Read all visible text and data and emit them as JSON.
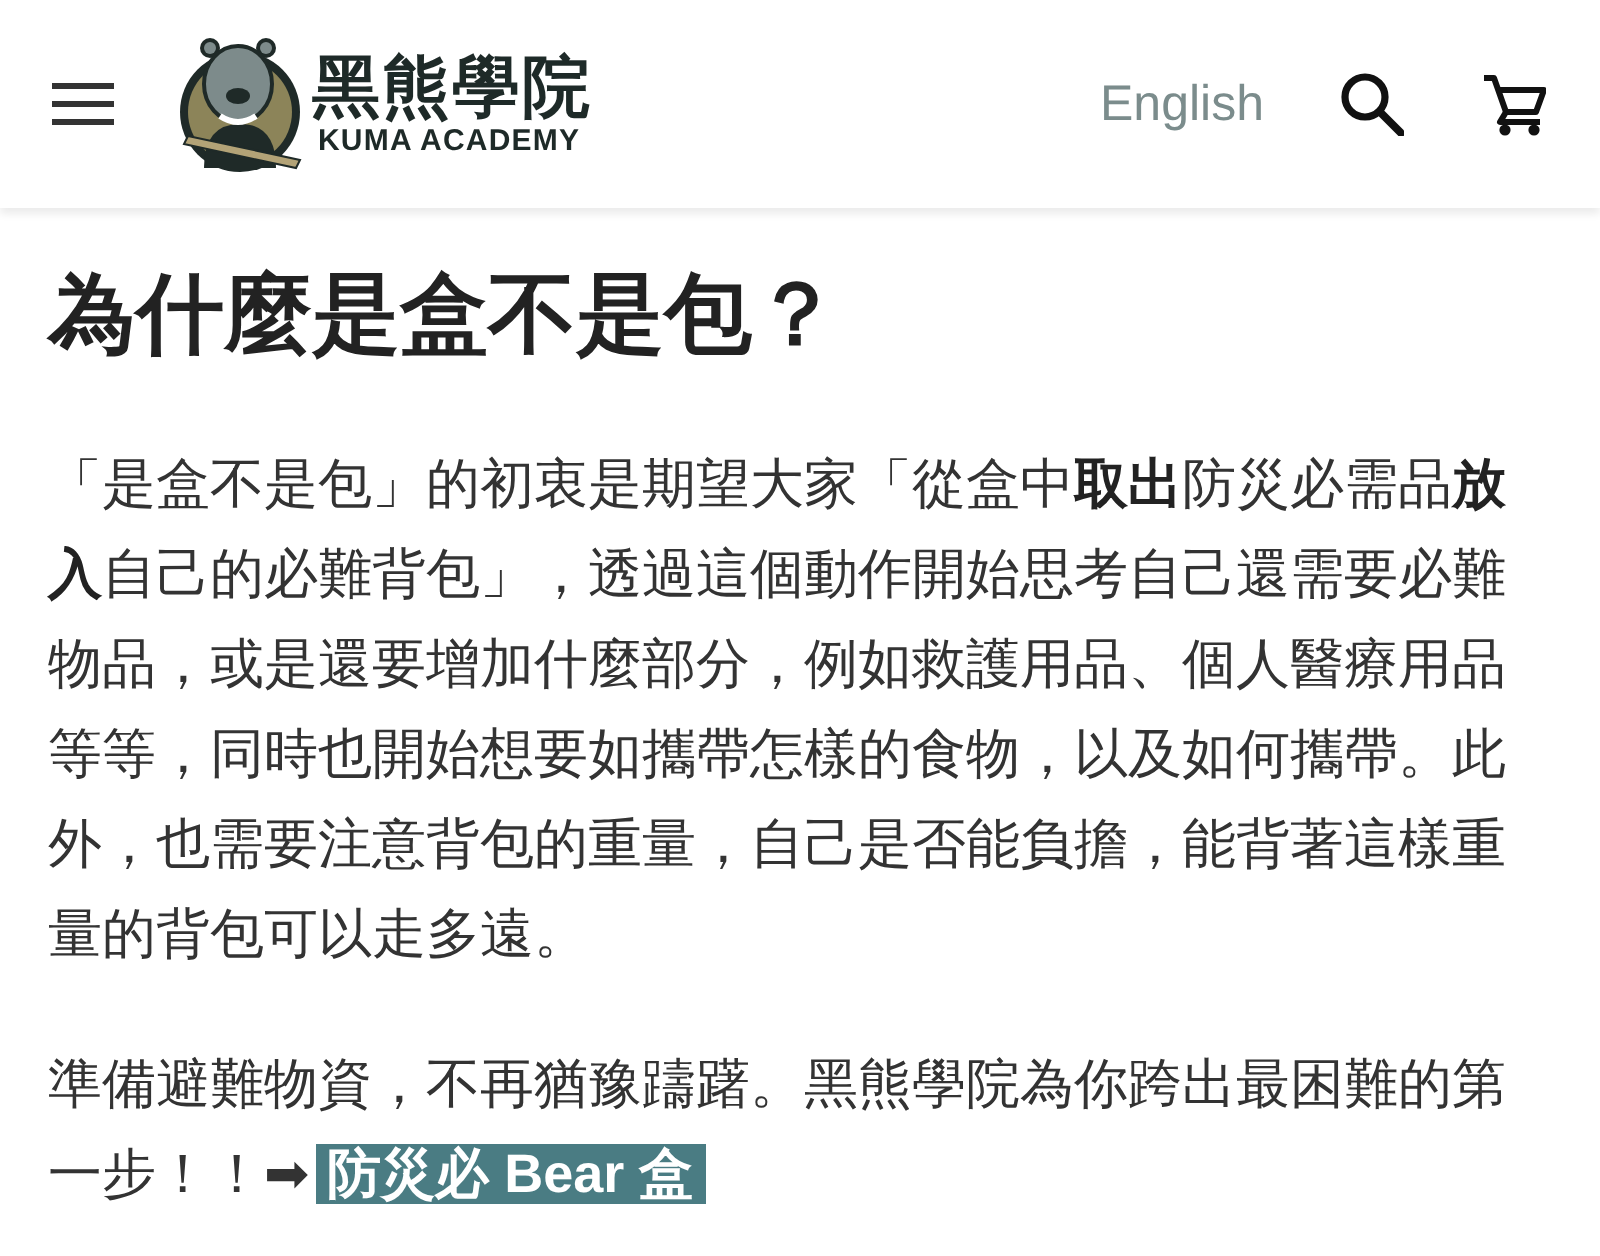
{
  "header": {
    "logo": {
      "title": "黑熊學院",
      "subtitle": "KUMA ACADEMY"
    },
    "language": "English"
  },
  "article": {
    "heading": "為什麼是盒不是包？",
    "paragraphs": [
      {
        "text": "「是盒不是包」的初衷是期望大家「從盒中**取出**防災必需品**放入**自己的必難背包」，透過這個動作開始思考自己還需要必難物品，或是還要增加什麼部分，例如救護用品、個人醫療用品等等，同時也開始想要如攜帶怎樣的食物，以及如何攜帶。此外，也需要注意背包的重量，自己是否能負擔，能背著這樣重量的背包可以走多遠。"
      },
      {
        "text": "準備避難物資，不再猶豫躊躇。黑熊學院為你跨出最困難的第一步！！➡",
        "link": "防災必 Bear 盒"
      }
    ]
  }
}
